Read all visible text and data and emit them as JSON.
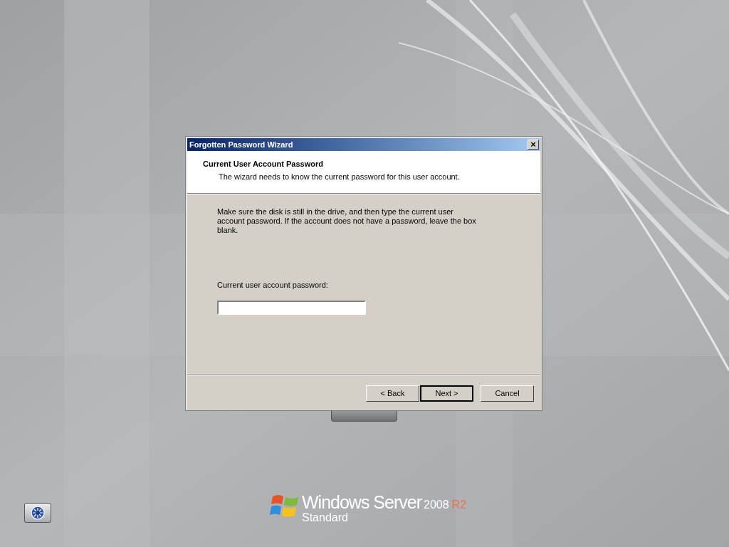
{
  "wizard": {
    "title": "Forgotten Password Wizard",
    "close": "×",
    "heading": "Current User Account Password",
    "subheading": "The wizard needs to know the current password for this user account.",
    "instructions": "Make sure the disk is still in the drive, and then type the current user account password. If the account does not have a password, leave the box blank.",
    "field_label": "Current user account password:",
    "buttons": [
      {
        "label": "< Back",
        "default": false
      },
      {
        "label": "Next >",
        "default": true
      },
      {
        "label": "Cancel",
        "default": false
      }
    ]
  },
  "logo": {
    "product": "Windows Server",
    "version": "2008",
    "release": "R2",
    "edition": "Standard"
  }
}
